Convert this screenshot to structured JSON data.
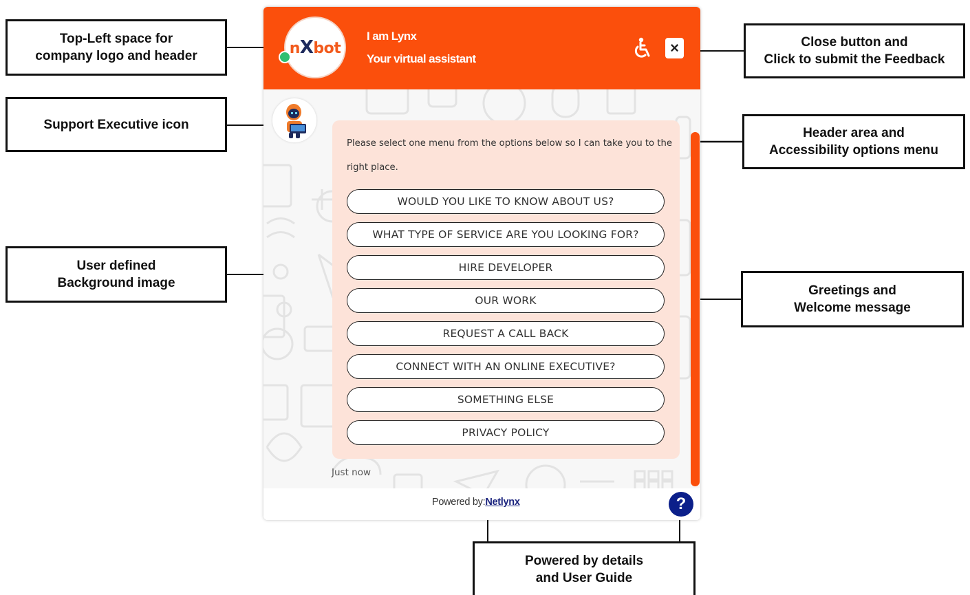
{
  "annotations": {
    "logo_header": "Top-Left space for\ncompany logo and header",
    "support_icon": "Support Executive icon",
    "background": "User defined\nBackground image",
    "close_feedback": "Close button and\nClick to submit the Feedback",
    "header_accessibility": "Header area and\nAccessibility options menu",
    "greetings": "Greetings and\nWelcome message",
    "powered_guide": "Powered by details\nand User Guide"
  },
  "widget": {
    "accent_color": "#fb4f0c",
    "logo": {
      "part1": "n",
      "part2": "X",
      "part3": "bot"
    },
    "bot_name": "I am Lynx",
    "bot_role": "Your virtual assistant",
    "accessibility_icon": "wheelchair-icon",
    "close_icon": "close-icon",
    "close_label": "×",
    "greeting": "Please select one menu from the options below so I can take you to the right place.",
    "menu_options": [
      "WOULD YOU LIKE TO KNOW ABOUT US?",
      "WHAT TYPE OF SERVICE ARE YOU LOOKING FOR?",
      "HIRE DEVELOPER",
      "OUR WORK",
      "REQUEST A CALL BACK",
      "CONNECT WITH AN ONLINE EXECUTIVE?",
      "SOMETHING ELSE",
      "PRIVACY POLICY"
    ],
    "timestamp": "Just now",
    "powered_by_label": "Powered by:",
    "powered_by_link": "Netlynx",
    "help_label": "?"
  }
}
